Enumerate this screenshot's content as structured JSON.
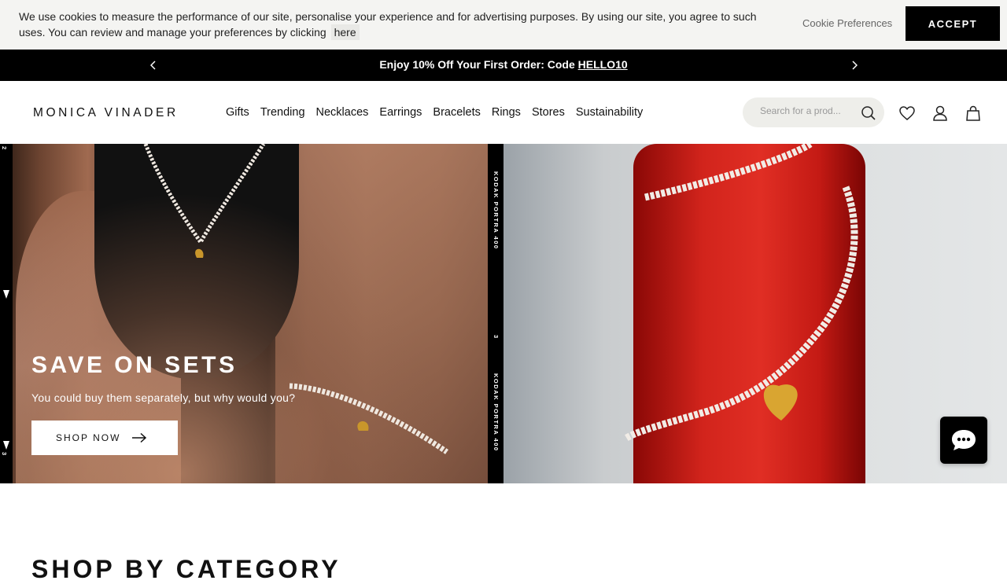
{
  "cookie_bar": {
    "message": "We use cookies to measure the performance of our site, personalise your experience and for advertising purposes. By using our site, you agree to such uses. You can review and manage your preferences by clicking",
    "link_label": "here",
    "preferences_label": "Cookie Preferences",
    "accept_label": "ACCEPT"
  },
  "promo": {
    "text": "Enjoy 10% Off Your First Order: Code",
    "code": "HELLO10",
    "prev_icon": "chevron-left-icon",
    "next_icon": "chevron-right-icon"
  },
  "header": {
    "logo": "MONICA VINADER",
    "nav": [
      "Gifts",
      "Trending",
      "Necklaces",
      "Earrings",
      "Bracelets",
      "Rings",
      "Stores",
      "Sustainability"
    ],
    "search_placeholder": "Search for a prod...",
    "icons": [
      "search-icon",
      "heart-icon",
      "user-icon",
      "bag-icon"
    ]
  },
  "hero": {
    "title": "SAVE ON SETS",
    "subtitle": "You could buy them separately, but why would you?",
    "cta": "SHOP NOW",
    "film_labels": [
      "KODAK PORTRA 400",
      "KODAK PORTRA 400"
    ],
    "film_numbers": [
      "2",
      "3",
      "3"
    ]
  },
  "chat": {
    "icon": "chat-bubble-icon"
  },
  "section": {
    "title": "SHOP BY CATEGORY"
  },
  "colors": {
    "black": "#000000",
    "cookie_bg": "#f4f4f2",
    "search_bg": "#eeeeea",
    "bottle_red": "#d2241c"
  }
}
